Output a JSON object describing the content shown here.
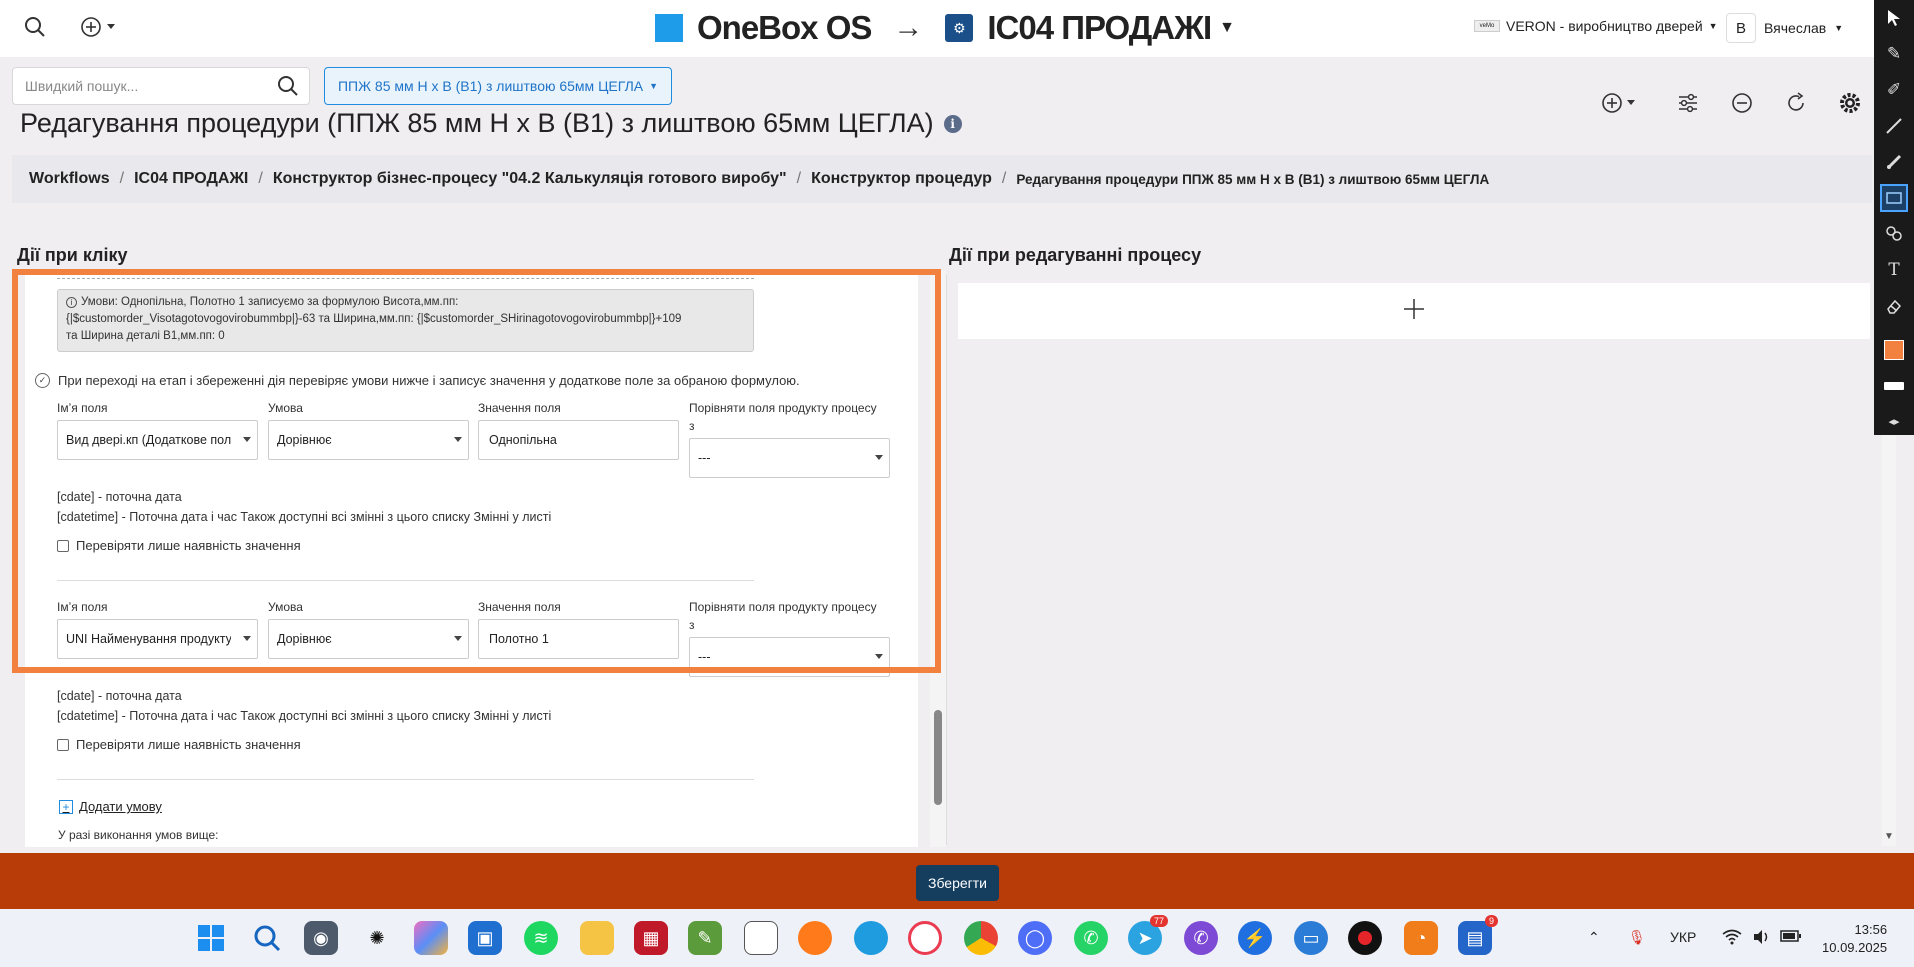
{
  "header": {
    "brand": "OneBox OS",
    "arrow": "→",
    "project": "ІС04 ПРОДАЖІ",
    "company": "VERON - виробництво дверей",
    "company_logo_text": "veMo",
    "user_initial": "В",
    "user_name": "Вячеслав"
  },
  "search": {
    "placeholder": "Швидкий пошук..."
  },
  "process_select": {
    "value": "ППЖ 85 мм Н х В (В1) з лиштвою 65мм ЦЕГЛА"
  },
  "page_title": "Редагування процедури (ППЖ 85 мм Н х В (В1) з лиштвою 65мм ЦЕГЛА)",
  "breadcrumb": [
    "Workflows",
    "ІС04 ПРОДАЖІ",
    "Конструктор бізнес-процесу \"04.2 Калькуляція готового виробу\"",
    "Конструктор процедур",
    "Редагування процедури ППЖ 85 мм Н х В (В1) з лиштвою 65мм ЦЕГЛА"
  ],
  "left_column_title": "Дії при кліку",
  "right_column_title": "Дії при редагуванні процесу",
  "conditions_info": {
    "line1": "Умови: Однопільна, Полотно 1 записуємо за формулою Висота,мм.пп:",
    "line2": "{|$customorder_Visotagotovogovirobummbp|}-63 та Ширина,мм.пп: {|$customorder_SHirinagotovogovirobummbp|}+109",
    "line3": "та Ширина деталі В1,мм.пп: 0"
  },
  "check_note": "При переході на етап і збереженні дія перевіряє умови нижче і записує значення у додаткове поле за обраною формулою.",
  "labels": {
    "field_name": "Імʼя поля",
    "condition": "Умова",
    "field_value": "Значення поля",
    "compare_line1": "Порівняти поля продукту процесу",
    "compare_line2": "з"
  },
  "conditions": [
    {
      "field": "Вид двері.кп (Додаткове поле",
      "condition": "Дорівнює",
      "value": "Однопільна",
      "compare": "---",
      "help1": "[cdate] - поточна дата",
      "help2": "[cdatetime] - Поточна дата і час Також доступні всі змінні з цього списку Змінні у листі",
      "checkbox": "Перевіряти лише наявність значення"
    },
    {
      "field": "UNI Найменування продукту",
      "condition": "Дорівнює",
      "value": "Полотно 1",
      "compare": "---",
      "help1": "[cdate] - поточна дата",
      "help2": "[cdatetime] - Поточна дата і час Також доступні всі змінні з цього списку Змінні у листі",
      "checkbox": "Перевіряти лише наявність значення"
    }
  ],
  "add_condition": "Додати умову",
  "if_conditions": "У разі виконання умов вище:",
  "save_button": "Зберегти",
  "tray": {
    "language": "УКР",
    "time": "13:56",
    "date": "10.09.2025",
    "badge_telegram": "77",
    "badge_last": "9"
  },
  "colors": {
    "accent": "#1f8ce0",
    "savebar": "#b83c07",
    "save_button": "#143d5e",
    "highlight": "#f2803f"
  }
}
